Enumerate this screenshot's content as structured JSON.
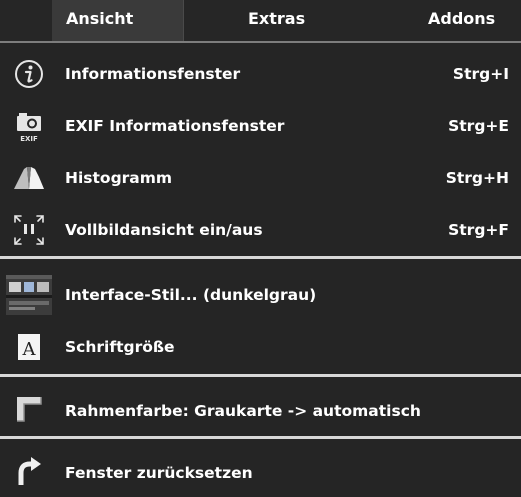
{
  "menubar": {
    "tabs": [
      {
        "label": "Ansicht",
        "active": true
      },
      {
        "label": "Extras",
        "active": false
      },
      {
        "label": "Addons",
        "active": false
      }
    ]
  },
  "menu": {
    "items": [
      {
        "label": "Informationsfenster",
        "shortcut": "Strg+I",
        "icon": "info-icon"
      },
      {
        "label": "EXIF Informationsfenster",
        "shortcut": "Strg+E",
        "icon": "exif-camera-icon"
      },
      {
        "label": "Histogramm",
        "shortcut": "Strg+H",
        "icon": "histogram-icon"
      },
      {
        "label": "Vollbildansicht ein/aus",
        "shortcut": "Strg+F",
        "icon": "fullscreen-icon"
      },
      {
        "label": "Interface-Stil... (dunkelgrau)",
        "shortcut": "",
        "icon": "interface-style-icon"
      },
      {
        "label": "Schriftgröße",
        "shortcut": "",
        "icon": "font-size-icon"
      },
      {
        "label": "Rahmenfarbe: Graukarte -> automatisch",
        "shortcut": "",
        "icon": "frame-color-icon"
      },
      {
        "label": "Fenster zurücksetzen",
        "shortcut": "",
        "icon": "reset-arrow-icon"
      }
    ],
    "exif_icon_text": "EXIF",
    "font_icon_text": "A"
  },
  "colors": {
    "background": "#252525",
    "active_tab": "#3a3a3a",
    "separator": "#d8d8d8",
    "text": "#ffffff"
  }
}
